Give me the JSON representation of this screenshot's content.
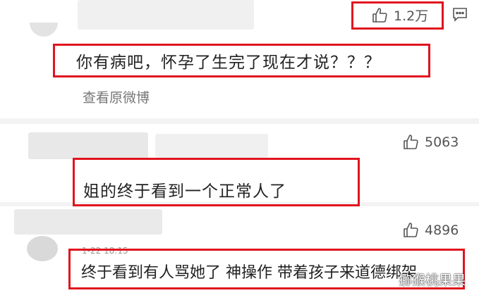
{
  "comments": [
    {
      "likes": "1.2万",
      "text": "你有病吧，怀孕了生完了现在才说？？？",
      "link": "查看原微博"
    },
    {
      "likes": "5063",
      "text": "姐的终于看到一个正常人了"
    },
    {
      "likes": "4896",
      "timestamp": "1-22 18:15",
      "text": "终于看到有人骂她了 神操作 带着孩子来道德绑架"
    }
  ],
  "watermark": "猕猴桃果果",
  "colors": {
    "highlight": "#e0141e",
    "background": "#f3f3f3"
  },
  "icons": [
    "thumbs-up-icon",
    "comment-icon"
  ]
}
